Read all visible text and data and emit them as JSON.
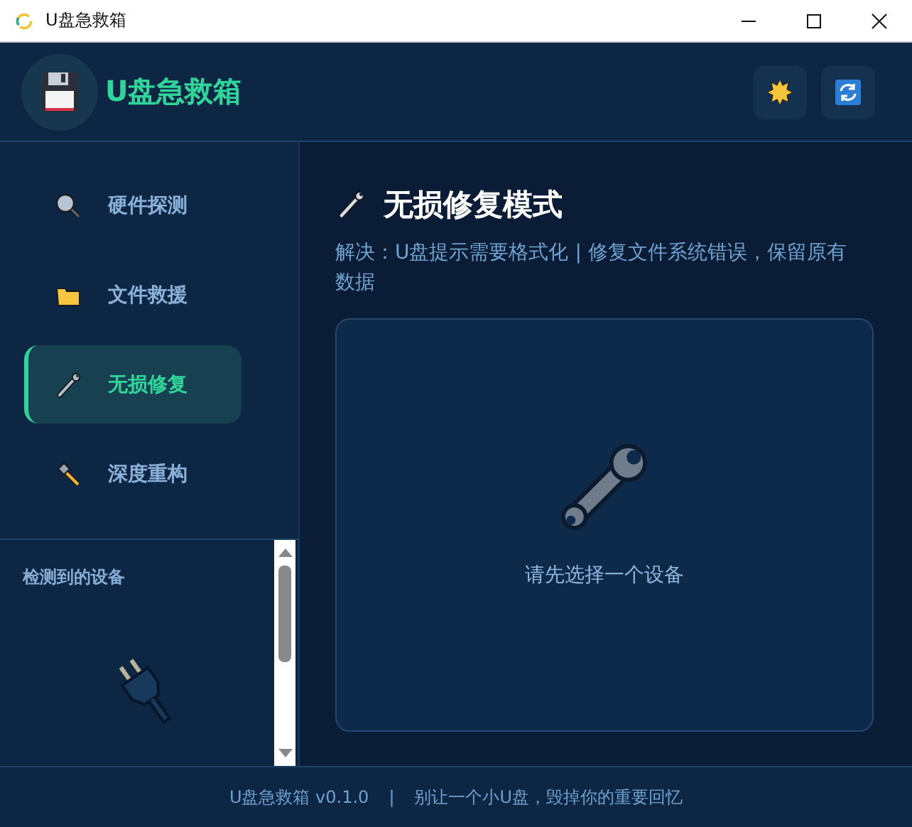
{
  "window": {
    "title": "U盘急救箱"
  },
  "header": {
    "app_name": "U盘急救箱"
  },
  "nav": [
    {
      "label": "硬件探测",
      "selected": false
    },
    {
      "label": "文件救援",
      "selected": false
    },
    {
      "label": "无损修复",
      "selected": true
    },
    {
      "label": "深度重构",
      "selected": false
    }
  ],
  "devices": {
    "title": "检测到的设备"
  },
  "main": {
    "title": "无损修复模式",
    "description": "解决：U盘提示需要格式化 | 修复文件系统错误，保留原有数据",
    "empty_message": "请先选择一个设备"
  },
  "status_bar": {
    "version": "U盘急救箱 v0.1.0",
    "separator": "|",
    "slogan": "别让一个小U盘，毁掉你的重要回忆"
  }
}
